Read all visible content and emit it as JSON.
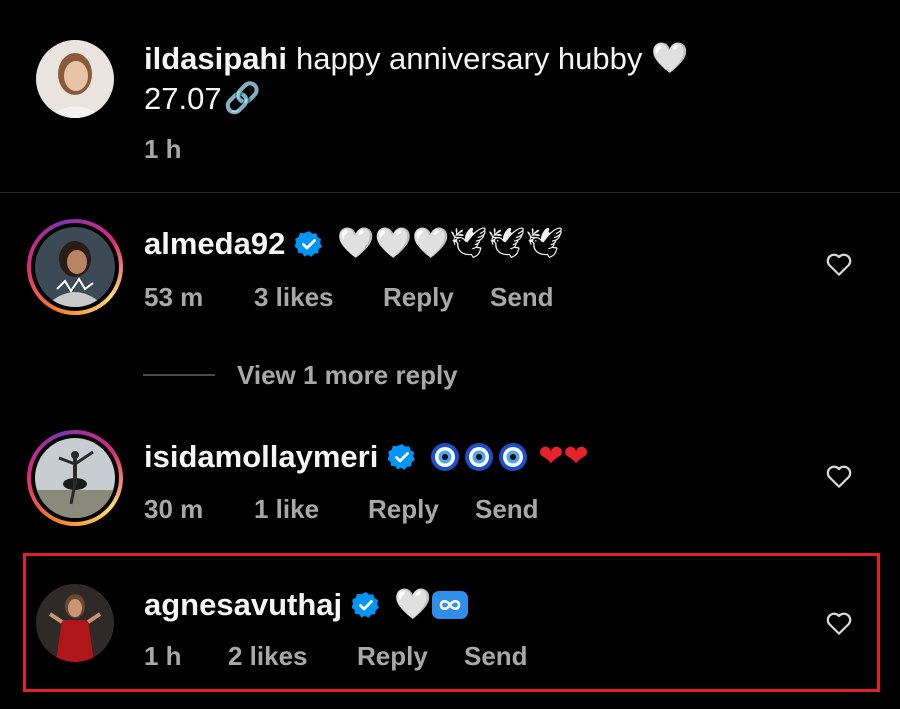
{
  "caption": {
    "username": "ildasipahi",
    "text": "happy anniversary hubby",
    "emoji_heart": "🤍",
    "second_line": "27.07",
    "link_emoji": "🔗",
    "time": "1 h"
  },
  "comments": [
    {
      "username": "almeda92",
      "verified": true,
      "emojis": "🤍🤍🤍🕊🕊🕊",
      "time": "53 m",
      "likes": "3 likes",
      "reply_label": "Reply",
      "send_label": "Send"
    },
    {
      "username": "isidamollaymeri",
      "verified": true,
      "emojis_red": "❤❤",
      "time": "30 m",
      "likes": "1 like",
      "reply_label": "Reply",
      "send_label": "Send"
    },
    {
      "username": "agnesavuthaj",
      "verified": true,
      "emojis": "🤍",
      "time": "1 h",
      "likes": "2 likes",
      "reply_label": "Reply",
      "send_label": "Send"
    }
  ],
  "view_more": "View 1 more reply",
  "colors": {
    "background": "#000000",
    "secondary_text": "#a8a8a8",
    "verified_blue": "#0095f6",
    "highlight_red": "#e0202a"
  }
}
